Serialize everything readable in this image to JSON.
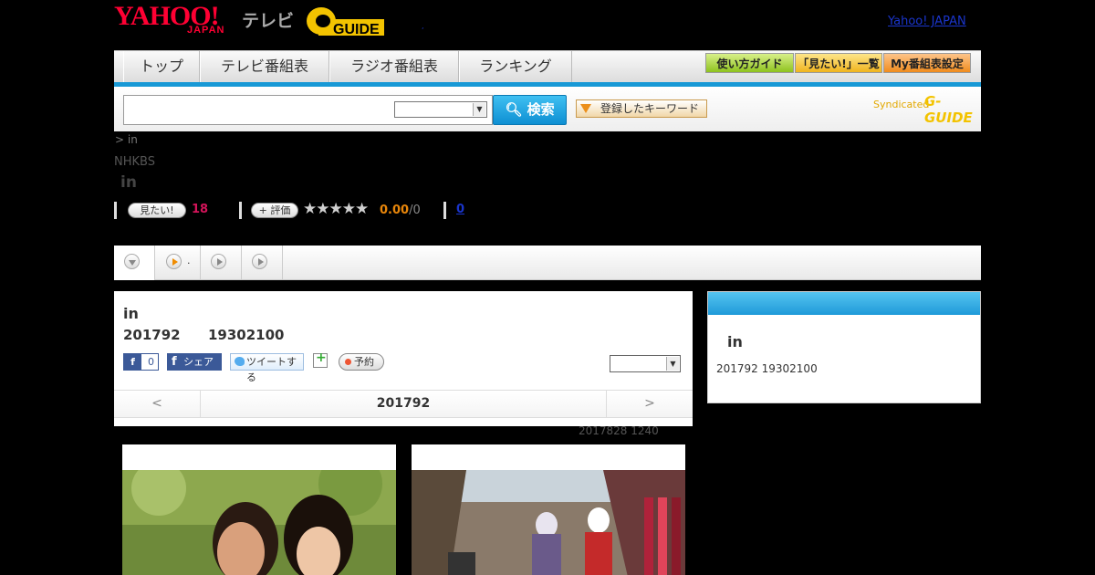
{
  "header": {
    "logo_yahoo": "YAHOO!",
    "logo_japan": "JAPAN",
    "logo_tv": "テレビ",
    "logo_gguide": "G-GUIDE",
    "yahoo_japan_link": "Yahoo! JAPAN",
    "dot": ","
  },
  "nav": {
    "tabs": [
      "トップ",
      "テレビ番組表",
      "ラジオ番組表",
      "ランキング"
    ],
    "buttons": [
      "使い方ガイド",
      "「見たい!」一覧",
      "My番組表設定"
    ]
  },
  "search": {
    "input_value": "",
    "select_value": "",
    "button_label": "検索",
    "keyword_button": "登録したキーワード",
    "syndicated": "Syndicated",
    "syndicated_logo": "G-GUIDE"
  },
  "program": {
    "breadcrumb": ">  in",
    "channel": "NHKBS",
    "title": "in",
    "mitai_label": "見たい!",
    "mitai_count": "18",
    "hyoka_label": "評価",
    "stars": "★★★★★",
    "rating": "0.00",
    "rating_count": "/0",
    "reviews": "0"
  },
  "tabs": [
    {
      "label": ""
    },
    {
      "label": "."
    },
    {
      "label": ""
    },
    {
      "label": ""
    }
  ],
  "detail": {
    "title": "in",
    "date": "201792",
    "time": "19302100",
    "fb_count": "0",
    "fb_letter": "f",
    "share_label": "シェア",
    "tweet_label": "ツイートする",
    "yoyaku_label": "予約",
    "select_value": "",
    "prev": "<",
    "current": "201792",
    "next": ">"
  },
  "updated": "2017828  1240",
  "side": {
    "title": "in",
    "date": "201792  19302100"
  },
  "colors": {
    "accent_blue": "#1899d6",
    "mitai_pink": "#d4145a",
    "rating_orange": "#e8860a"
  }
}
